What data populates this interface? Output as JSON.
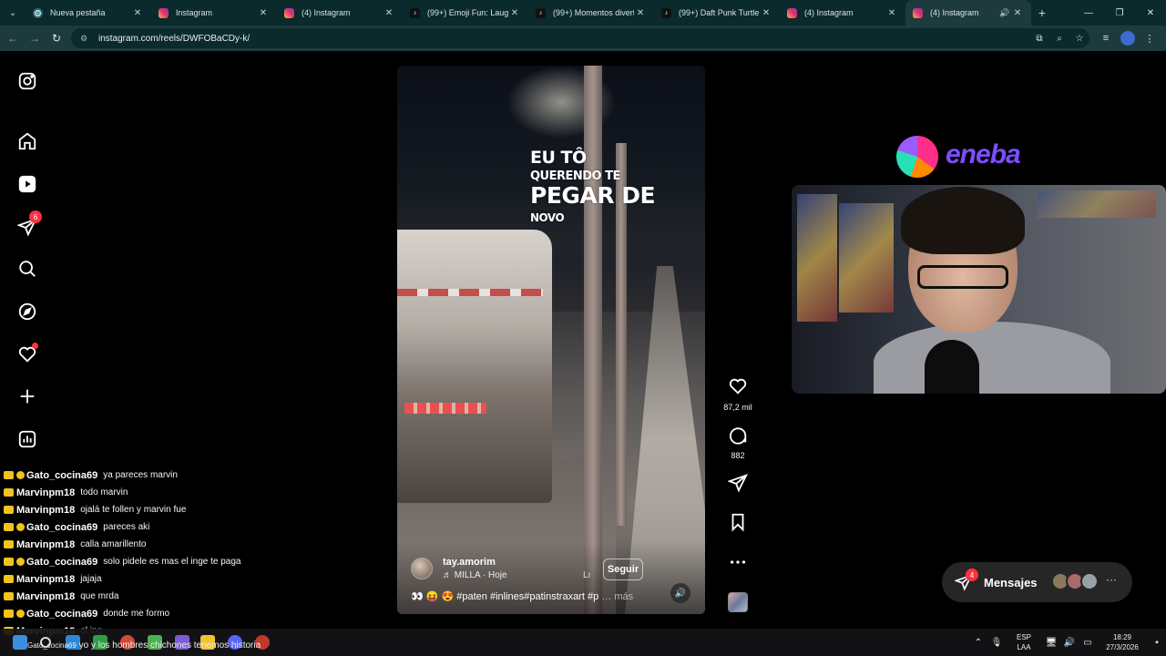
{
  "browser": {
    "tabs": [
      {
        "title": "Nueva pestaña",
        "icon": "chrome-icon",
        "active": false
      },
      {
        "title": "Instagram",
        "icon": "instagram-icon",
        "active": false
      },
      {
        "title": "(4) Instagram",
        "icon": "instagram-icon",
        "active": false
      },
      {
        "title": "(99+) Emoji Fun: Laughing",
        "icon": "tiktok-icon",
        "active": false
      },
      {
        "title": "(99+) Momentos divertidos",
        "icon": "tiktok-icon",
        "active": false
      },
      {
        "title": "(99+) Daft Punk Turtle Pra",
        "icon": "tiktok-icon",
        "active": false
      },
      {
        "title": "(4) Instagram",
        "icon": "instagram-icon",
        "active": false
      },
      {
        "title": "(4) Instagram",
        "icon": "instagram-icon",
        "active": true
      }
    ],
    "url": "instagram.com/reels/DWFOBaCDy-k/"
  },
  "sidebar": {
    "notifications_badge": "6"
  },
  "reel": {
    "overlay": {
      "line1": "EU TÔ",
      "line2": "QUERENDO TE",
      "line3": "PEGAR DE",
      "line4": "NOVO"
    },
    "author": "tay.amorim",
    "song": "♬ MILLA · Hoje",
    "song_extra": "Lı",
    "follow_label": "Seguir",
    "caption": "👀 😝 😍 #paten #inlines#patinstraxart #p",
    "caption_more": "… más",
    "likes": "87,2 mil",
    "comments": "882"
  },
  "sponsor": {
    "name": "eneba"
  },
  "chat": [
    {
      "user": "Gato_cocina69",
      "msg": "ya pareces marvin",
      "color": "#ffffff",
      "double": true
    },
    {
      "user": "Marvinpm18",
      "msg": "todo marvin",
      "color": "#ffffff",
      "double": false
    },
    {
      "user": "Marvinpm18",
      "msg": "ojalá te follen y marvin fue",
      "color": "#ffffff",
      "double": false
    },
    {
      "user": "Gato_cocina69",
      "msg": "pareces aki",
      "color": "#ffffff",
      "double": true
    },
    {
      "user": "Marvinpm18",
      "msg": "calla amarillento",
      "color": "#ffffff",
      "double": false
    },
    {
      "user": "Gato_cocina69",
      "msg": "solo pidele es mas el inge te paga",
      "color": "#ffffff",
      "double": true
    },
    {
      "user": "Marvinpm18",
      "msg": "jajaja",
      "color": "#ffffff",
      "double": false
    },
    {
      "user": "Marvinpm18",
      "msg": "que mrda",
      "color": "#ffffff",
      "double": false
    },
    {
      "user": "Gato_cocina69",
      "msg": "donde me formo",
      "color": "#ffffff",
      "double": true
    },
    {
      "user": "Marvinpm18",
      "msg": "el ing",
      "color": "#ffffff",
      "double": false
    }
  ],
  "chat_last": {
    "user": "Gato_cocina69",
    "msg": "yo y los hombres chichones tenemos historia"
  },
  "messages": {
    "label": "Mensajes",
    "badge": "4"
  },
  "tray": {
    "lang1": "ESP",
    "lang2": "LAA",
    "time": "18:29",
    "date": "27/3/2026"
  }
}
